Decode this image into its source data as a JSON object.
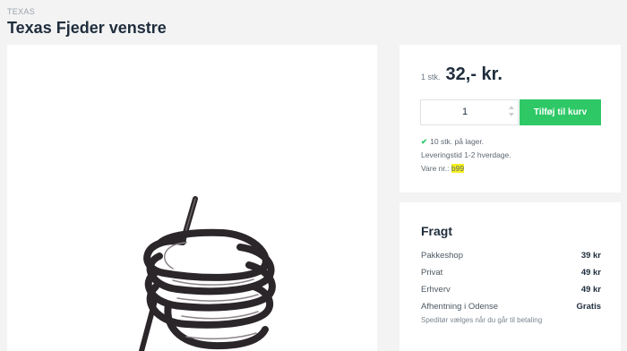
{
  "product": {
    "brand": "TEXAS",
    "title": "Texas Fjeder venstre"
  },
  "purchase": {
    "quantity_unit": "1 stk.",
    "price": "32,- kr.",
    "quantity": "1",
    "add_to_cart_label": "Tilføj til kurv",
    "stock_text": "10 stk. på lager.",
    "delivery_text": "Leveringstid 1-2 hverdage.",
    "sku_label": "Vare nr.: ",
    "sku_value": "b99",
    "check_icon": "check-icon"
  },
  "shipping": {
    "title": "Fragt",
    "rows": [
      {
        "name": "Pakkeshop",
        "price": "39 kr"
      },
      {
        "name": "Privat",
        "price": "49 kr"
      },
      {
        "name": "Erhverv",
        "price": "49 kr"
      },
      {
        "name": "Afhentning i Odense",
        "price": "Gratis"
      }
    ],
    "note": "Speditør vælges når du går til betaling"
  },
  "colors": {
    "accent_green": "#2ec866",
    "highlight_yellow": "#f4f01f",
    "text_dark": "#1f2d3d",
    "background": "#f3f3f3"
  }
}
